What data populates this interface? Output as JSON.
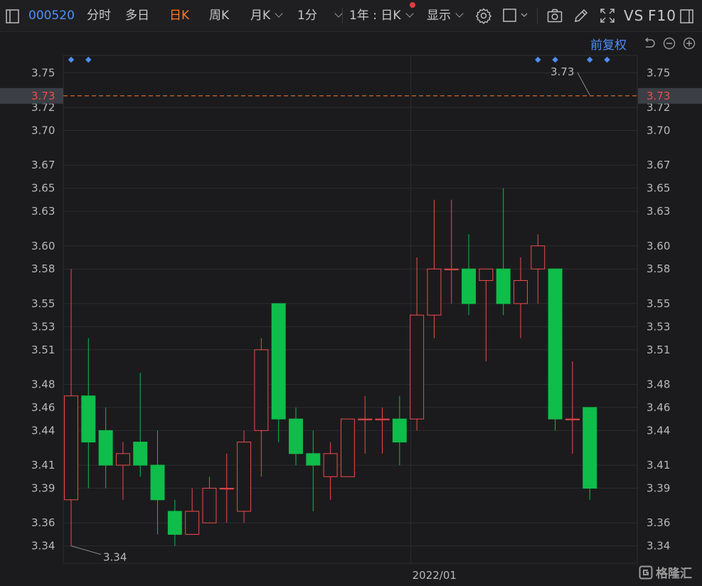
{
  "toolbar": {
    "code": "000520",
    "fenshi": "分时",
    "duori": "多日",
    "rik": "日K",
    "zhouk": "周K",
    "yuek": "月K",
    "min1": "1分",
    "range": "1年 : 日K",
    "display": "显示",
    "vs": "VS",
    "f10": "F10"
  },
  "fuquan_label": "前复权",
  "watermark_text": "格隆汇",
  "colors": {
    "up": "#f04b4b",
    "down": "#0fbd4a",
    "accent": "#4f8ef7",
    "active_tab": "#ff7a2e",
    "price_line": "#ff7a2e"
  },
  "chart_data": {
    "type": "candlestick",
    "ylim": [
      3.325,
      3.765
    ],
    "ticks": [
      "3.75",
      "3.72",
      "3.70",
      "3.67",
      "3.65",
      "3.63",
      "3.60",
      "3.58",
      "3.55",
      "3.53",
      "3.51",
      "3.48",
      "3.46",
      "3.44",
      "3.41",
      "3.39",
      "3.36",
      "3.34"
    ],
    "x_label": "2022/01",
    "x_label_index": 20,
    "current_price": "3.73",
    "max_label": "3.73",
    "min_label": "3.34",
    "candles": [
      {
        "o": 3.38,
        "h": 3.58,
        "l": 3.34,
        "c": 3.47
      },
      {
        "o": 3.47,
        "h": 3.52,
        "l": 3.39,
        "c": 3.43
      },
      {
        "o": 3.44,
        "h": 3.46,
        "l": 3.39,
        "c": 3.41
      },
      {
        "o": 3.41,
        "h": 3.43,
        "l": 3.38,
        "c": 3.42
      },
      {
        "o": 3.43,
        "h": 3.49,
        "l": 3.4,
        "c": 3.41
      },
      {
        "o": 3.41,
        "h": 3.44,
        "l": 3.35,
        "c": 3.38
      },
      {
        "o": 3.37,
        "h": 3.38,
        "l": 3.34,
        "c": 3.35
      },
      {
        "o": 3.35,
        "h": 3.39,
        "l": 3.35,
        "c": 3.37
      },
      {
        "o": 3.36,
        "h": 3.4,
        "l": 3.36,
        "c": 3.39
      },
      {
        "o": 3.39,
        "h": 3.42,
        "l": 3.36,
        "c": 3.39
      },
      {
        "o": 3.37,
        "h": 3.44,
        "l": 3.36,
        "c": 3.43
      },
      {
        "o": 3.44,
        "h": 3.52,
        "l": 3.4,
        "c": 3.51
      },
      {
        "o": 3.55,
        "h": 3.55,
        "l": 3.43,
        "c": 3.45
      },
      {
        "o": 3.45,
        "h": 3.46,
        "l": 3.41,
        "c": 3.42
      },
      {
        "o": 3.42,
        "h": 3.44,
        "l": 3.37,
        "c": 3.41
      },
      {
        "o": 3.4,
        "h": 3.43,
        "l": 3.38,
        "c": 3.42
      },
      {
        "o": 3.4,
        "h": 3.45,
        "l": 3.4,
        "c": 3.45
      },
      {
        "o": 3.45,
        "h": 3.47,
        "l": 3.42,
        "c": 3.45
      },
      {
        "o": 3.45,
        "h": 3.46,
        "l": 3.42,
        "c": 3.45
      },
      {
        "o": 3.45,
        "h": 3.47,
        "l": 3.41,
        "c": 3.43
      },
      {
        "o": 3.45,
        "h": 3.59,
        "l": 3.44,
        "c": 3.54
      },
      {
        "o": 3.54,
        "h": 3.64,
        "l": 3.52,
        "c": 3.58
      },
      {
        "o": 3.58,
        "h": 3.64,
        "l": 3.55,
        "c": 3.58
      },
      {
        "o": 3.58,
        "h": 3.61,
        "l": 3.54,
        "c": 3.55
      },
      {
        "o": 3.57,
        "h": 3.58,
        "l": 3.5,
        "c": 3.58
      },
      {
        "o": 3.58,
        "h": 3.65,
        "l": 3.54,
        "c": 3.55
      },
      {
        "o": 3.55,
        "h": 3.59,
        "l": 3.52,
        "c": 3.57
      },
      {
        "o": 3.58,
        "h": 3.61,
        "l": 3.55,
        "c": 3.6
      },
      {
        "o": 3.58,
        "h": 3.58,
        "l": 3.44,
        "c": 3.45
      },
      {
        "o": 3.45,
        "h": 3.5,
        "l": 3.42,
        "c": 3.45
      },
      {
        "o": 3.46,
        "h": 3.46,
        "l": 3.38,
        "c": 3.39
      }
    ],
    "markers_index": [
      0,
      1,
      27,
      28,
      30,
      31
    ]
  }
}
